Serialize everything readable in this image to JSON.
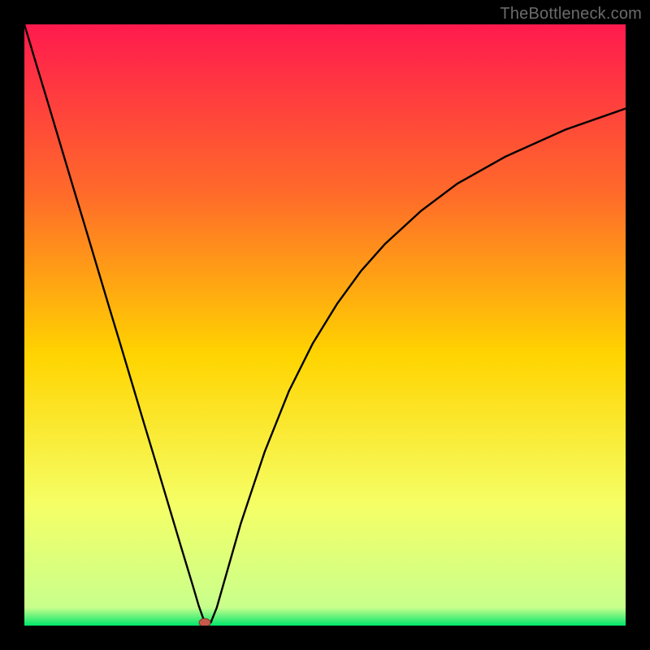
{
  "watermark": "TheBottleneck.com",
  "colors": {
    "frame": "#000000",
    "gradient_top": "#ff1a4e",
    "gradient_mid1": "#ff6a2a",
    "gradient_mid2": "#ffd400",
    "gradient_mid3": "#f5ff66",
    "gradient_bottom": "#00e56a",
    "curve": "#000000",
    "marker_fill": "#c65a4a",
    "marker_stroke": "#7a3328"
  },
  "chart_data": {
    "type": "line",
    "title": "",
    "xlabel": "",
    "ylabel": "",
    "x_range": [
      0,
      100
    ],
    "y_range": [
      0,
      100
    ],
    "minimum_x": 30,
    "series": [
      {
        "name": "bottleneck-curve",
        "x": [
          0,
          2,
          4,
          6,
          8,
          10,
          12,
          14,
          16,
          18,
          20,
          22,
          24,
          26,
          27,
          28,
          29,
          30,
          31,
          32,
          34,
          36,
          38,
          40,
          44,
          48,
          52,
          56,
          60,
          66,
          72,
          80,
          90,
          100
        ],
        "y": [
          100,
          93.3,
          86.7,
          80,
          73.3,
          66.7,
          60,
          53.3,
          46.7,
          40,
          33.3,
          26.7,
          20,
          13.3,
          10,
          6.7,
          3.3,
          0.5,
          0.5,
          3,
          10,
          17,
          23,
          29,
          39,
          47,
          53.5,
          59,
          63.5,
          69,
          73.5,
          78,
          82.5,
          86
        ]
      }
    ],
    "marker": {
      "x": 30,
      "y": 0.5
    },
    "gradient_stops": [
      {
        "offset": 0.0,
        "color": "#ff1a4e"
      },
      {
        "offset": 0.28,
        "color": "#ff6a2a"
      },
      {
        "offset": 0.55,
        "color": "#ffd400"
      },
      {
        "offset": 0.8,
        "color": "#f5ff66"
      },
      {
        "offset": 0.97,
        "color": "#c8ff8c"
      },
      {
        "offset": 1.0,
        "color": "#00e56a"
      }
    ]
  }
}
